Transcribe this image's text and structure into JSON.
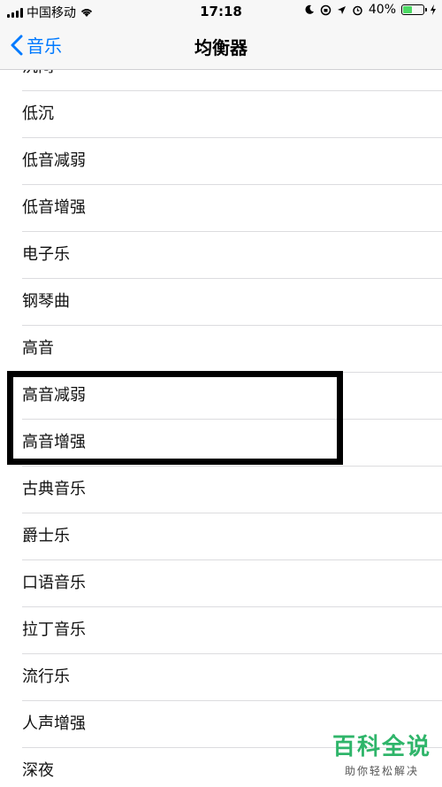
{
  "status_bar": {
    "carrier": "中国移动",
    "time": "17:18",
    "battery_percent": "40%"
  },
  "nav": {
    "back_label": "音乐",
    "title": "均衡器"
  },
  "equalizer_options": [
    "沉闷",
    "低沉",
    "低音减弱",
    "低音增强",
    "电子乐",
    "钢琴曲",
    "高音",
    "高音减弱",
    "高音增强",
    "古典音乐",
    "爵士乐",
    "口语音乐",
    "拉丁音乐",
    "流行乐",
    "人声增强",
    "深夜"
  ],
  "watermark": {
    "title": "百科全说",
    "subtitle": "助你轻松解决"
  },
  "colors": {
    "accent": "#007aff",
    "watermark": "#2fb56a",
    "battery": "#4cd964"
  }
}
